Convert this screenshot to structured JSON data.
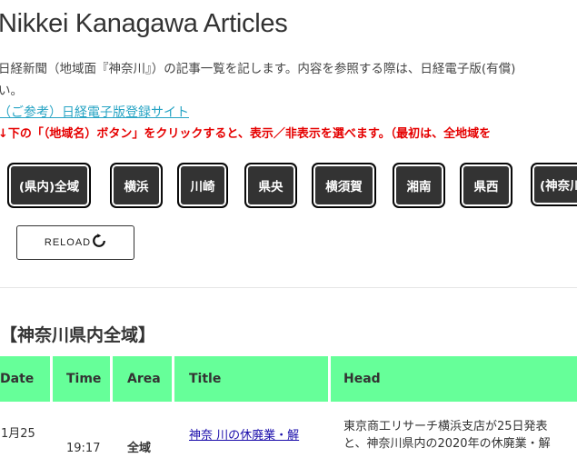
{
  "page_title": "Nikkei Kanagawa Articles",
  "intro_line1": "日経新聞（地域面『神奈川』）の記事一覧を記します。内容を参照する際は、日経電子版(有償)",
  "intro_line2": "い。",
  "reference_link": "（ご参考）日経電子版登録サイト",
  "notice": "↓下の「（地域名）ボタン」をクリックすると、表示／非表示を選べます。（最初は、全地域を",
  "region_buttons": [
    "(県内)全域",
    "横浜",
    "川崎",
    "県央",
    "横須賀",
    "湘南",
    "県西",
    "(神奈川"
  ],
  "reload_label": "RELOAD",
  "section_title": "【神奈川県内全域】",
  "table": {
    "headers": [
      "Date",
      "Time",
      "Area",
      "Title",
      "Head"
    ],
    "rows": [
      {
        "date": "1月25",
        "time": "19:17",
        "area": "全域",
        "title": "神奈 川の休廃業・解",
        "head_line1": "東京商工リサーチ横浜支店が25日発表",
        "head_line2": "と、神奈川県内の2020年の休廃業・解"
      }
    ]
  },
  "colors": {
    "button_bg": "#333333",
    "header_bg": "#66ff99",
    "notice": "#e50000",
    "link": "#27a4c4"
  }
}
